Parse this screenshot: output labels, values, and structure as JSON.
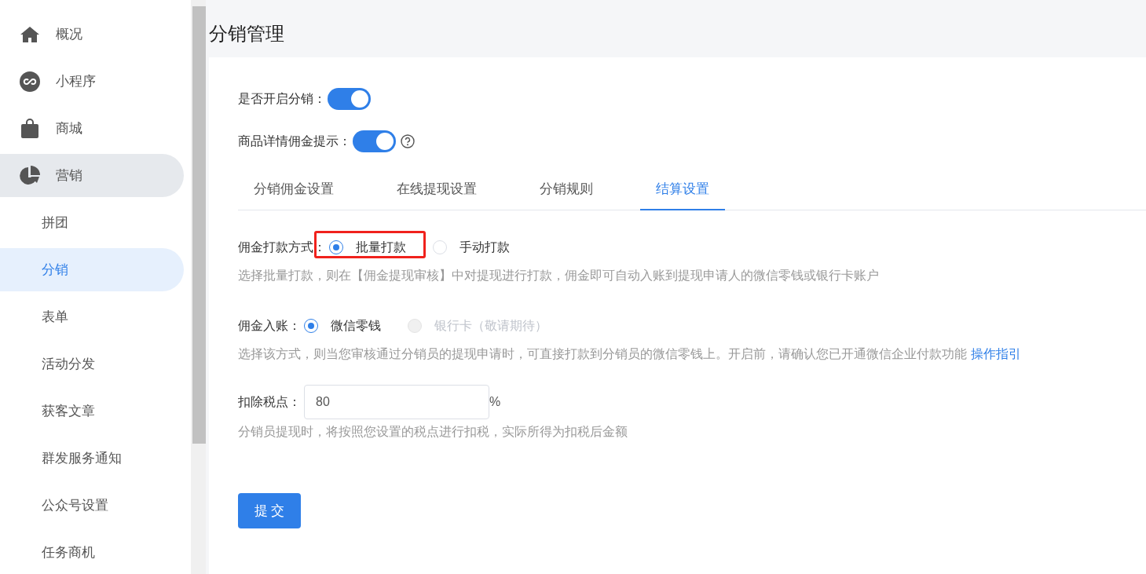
{
  "sidebar": {
    "items": [
      {
        "label": "概况",
        "expanded": false,
        "selected": false
      },
      {
        "label": "小程序",
        "expanded": false,
        "selected": false
      },
      {
        "label": "商城",
        "expanded": false,
        "selected": false
      },
      {
        "label": "营销",
        "expanded": true,
        "selected": false,
        "children": [
          {
            "label": "拼团",
            "selected": false
          },
          {
            "label": "分销",
            "selected": true
          },
          {
            "label": "表单",
            "selected": false
          },
          {
            "label": "活动分发",
            "selected": false
          },
          {
            "label": "获客文章",
            "selected": false
          },
          {
            "label": "群发服务通知",
            "selected": false
          },
          {
            "label": "公众号设置",
            "selected": false
          },
          {
            "label": "任务商机",
            "selected": false
          }
        ]
      }
    ]
  },
  "page_title": "分销管理",
  "switches": [
    {
      "label": "是否开启分销：",
      "on": true,
      "help": false
    },
    {
      "label": "商品详情佣金提示：",
      "on": true,
      "help": true
    }
  ],
  "tabs": [
    {
      "label": "分销佣金设置",
      "selected": false
    },
    {
      "label": "在线提现设置",
      "selected": false
    },
    {
      "label": "分销规则",
      "selected": false
    },
    {
      "label": "结算设置",
      "selected": true
    }
  ],
  "payment_method": {
    "label": "佣金打款方式：",
    "options": [
      {
        "label": "批量打款",
        "selected": true,
        "disabled": false,
        "highlighted": true
      },
      {
        "label": "手动打款",
        "selected": false,
        "disabled": false,
        "highlighted": false
      }
    ],
    "hint": "选择批量打款，则在【佣金提现审核】中对提现进行打款，佣金即可自动入账到提现申请人的微信零钱或银行卡账户"
  },
  "account": {
    "label": "佣金入账：",
    "options": [
      {
        "label": "微信零钱",
        "selected": true,
        "disabled": false,
        "highlighted": false
      },
      {
        "label": "银行卡（敬请期待）",
        "selected": false,
        "disabled": true,
        "highlighted": false
      }
    ],
    "hint": "选择该方式，则当您审核通过分销员的提现申请时，可直接打款到分销员的微信零钱上。开启前，请确认您已开通微信企业付款功能",
    "link": "操作指引"
  },
  "tax": {
    "label": "扣除税点：",
    "value": "80",
    "unit": "%",
    "hint": "分销员提现时，将按照您设置的税点进行扣税，实际所得为扣税后金额"
  },
  "submit": "提 交"
}
